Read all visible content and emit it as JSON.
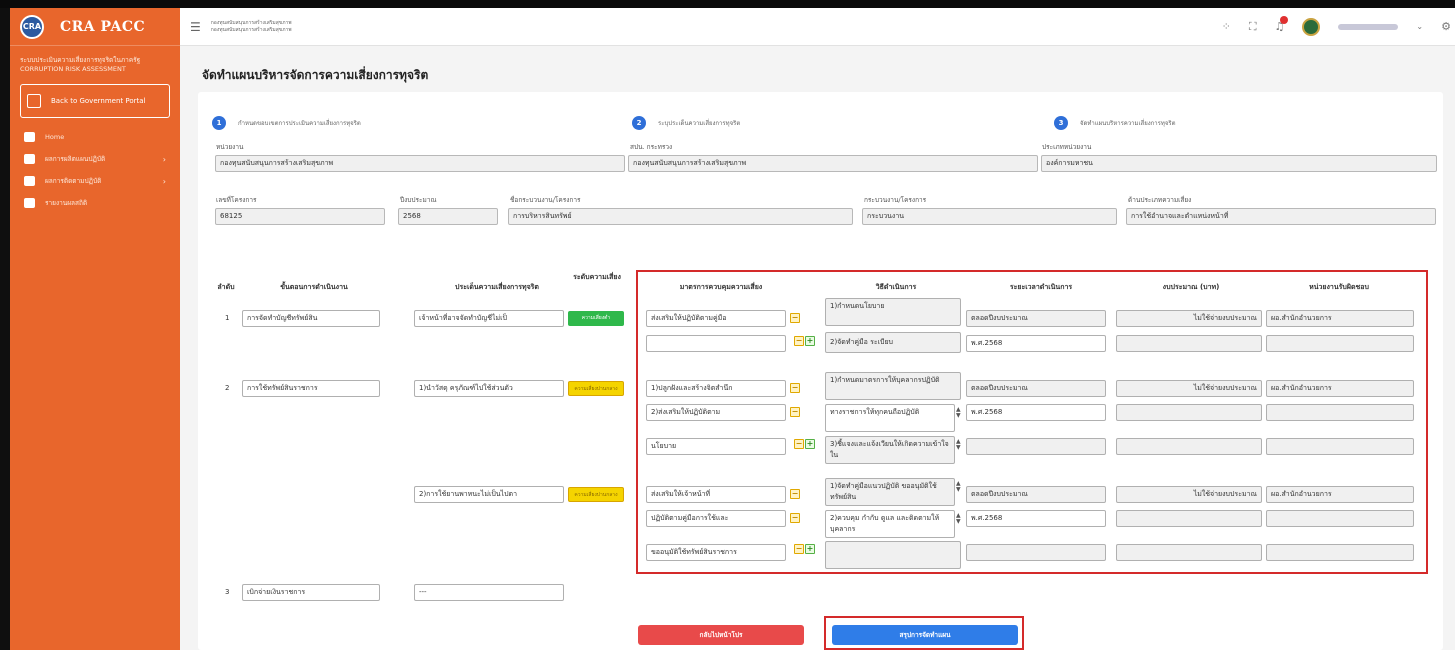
{
  "app": {
    "name": "CRA PACC",
    "logo_text": "CRA"
  },
  "sidebar": {
    "subtitle": "ระบบประเมินความเสี่ยงการทุจริตในภาครัฐ CORRUPTION RISK ASSESSMENT",
    "back_button": "Back to Government Portal",
    "items": [
      {
        "label": "Home",
        "icon": "home-icon"
      },
      {
        "label": "ผลการผลิตแผนปฏิบัติ",
        "icon": "edit-icon"
      },
      {
        "label": "ผลการติดตามปฏิบัติ",
        "icon": "document-icon"
      },
      {
        "label": "รายงานผลสถิติ",
        "icon": "chart-icon"
      }
    ]
  },
  "header": {
    "breadcrumb_line1": "กองทุนสนับสนุนการสร้างเสริมสุขภาพ",
    "breadcrumb_line2": "กองทุนสนับสนุนการสร้างเสริมสุขภาพ"
  },
  "page": {
    "title": "จัดทำแผนบริหารจัดการความเสี่ยงการทุจริต"
  },
  "steps": [
    {
      "num": "1",
      "label": "กำหนดขอบเขตการประเมินความเสี่ยงการทุจริต"
    },
    {
      "num": "2",
      "label": "ระบุประเด็นความเสี่ยงการทุจริต"
    },
    {
      "num": "3",
      "label": "จัดทำแผนบริหารความเสี่ยงการทุจริต"
    }
  ],
  "form": {
    "agency_label": "หน่วยงาน",
    "agency_value": "กองทุนสนับสนุนการสร้างเสริมสุขภาพ",
    "ministry_label": "สปน. กระทรวง",
    "ministry_value": "กองทุนสนับสนุนการสร้างเสริมสุขภาพ",
    "type_label": "ประเภทหน่วยงาน",
    "type_value": "องค์การมหาชน",
    "project_no_label": "เลขที่โครงการ",
    "project_no_value": "68125",
    "year_label": "ปีงบประมาณ",
    "year_value": "2568",
    "project_name_label": "ชื่อกระบวนงาน/โครงการ",
    "project_name_value": "การบริหารสินทรัพย์",
    "process_label": "กระบวนงาน/โครงการ",
    "process_value": "กระบวนงาน",
    "risk_type_label": "ด้านประเภทความเสี่ยง",
    "risk_type_value": "การใช้อำนาจและตำแหน่งหน้าที่"
  },
  "table": {
    "headers": [
      "ลำดับ",
      "ขั้นตอนการดำเนินงาน",
      "ประเด็นความเสี่ยงการทุจริต",
      "ระดับความเสี่ยง",
      "มาตรการควบคุมความเสี่ยง",
      "วิธีดำเนินการ",
      "ระยะเวลาดำเนินการ",
      "งบประมาณ (บาท)",
      "หน่วยงานรับผิดชอบ"
    ],
    "row1": {
      "num": "1",
      "step": "การจัดทำบัญชีทรัพย์สิน",
      "risk": "เจ้าหน้าที่อาจจัดทำบัญชีไม่เป็",
      "level": "ความเสี่ยงต่ำ",
      "measure1": "ส่งเสริมให้ปฏิบัติตามคู่มือ",
      "measure2": "",
      "method1": "1)กำหนดนโยบาย",
      "method2": "2)จัดทำคู่มือ ระเบียบ",
      "period1": "ตลอดปีงบประมาณ",
      "period2": "พ.ศ.2568",
      "budget1": "ไม่ใช้จ่ายงบประมาณ",
      "unit1": "ผอ.สำนักอำนวยการ"
    },
    "row2": {
      "num": "2",
      "step": "การใช้ทรัพย์สินราชการ",
      "risk": "1)นำวัสดุ ครุภัณฑ์ไปใช้ส่วนตัว",
      "level": "ความเสี่ยงปานกลาง",
      "measure1": "1)ปลูกฝังและสร้างจิตสำนึก",
      "measure2": "2)ส่งเสริมให้ปฏิบัติตาม",
      "measure3": "นโยบาย",
      "method1": "1)กำหนดมาตรการให้บุคลากรปฏิบัติ",
      "method2": "ทางราชการให้ทุกคนถือปฏิบัติ",
      "method3": "3)ชี้แจงและแจ้งเวียนให้เกิดความเข้าใจใน",
      "period1": "ตลอดปีงบประมาณ",
      "period2": "พ.ศ.2568",
      "budget1": "ไม่ใช้จ่ายงบประมาณ",
      "unit1": "ผอ.สำนักอำนวยการ"
    },
    "row2b": {
      "risk": "2)การใช้ยานพาหนะไม่เป็นไปตา",
      "level": "ความเสี่ยงปานกลาง",
      "measure1": "ส่งเสริมให้เจ้าหน้าที่",
      "measure2": "ปฏิบัติตามคู่มือการใช้และ",
      "measure3": "ขออนุมัติใช้ทรัพย์สินราชการ",
      "method1": "1)จัดทำคู่มือแนวปฏิบัติ ขออนุมัติใช้ทรัพย์สิน",
      "method2": "2)ควบคุม กำกับ ดูแล และติดตามให้บุคลากร",
      "period1": "ตลอดปีงบประมาณ",
      "period2": "พ.ศ.2568",
      "budget1": "ไม่ใช้จ่ายงบประมาณ",
      "unit1": "ผอ.สำนักอำนวยการ"
    },
    "row3": {
      "num": "3",
      "step": "เบิกจ่ายเงินราชการ",
      "risk": "---"
    }
  },
  "buttons": {
    "back": "กลับไปหน้าโปร",
    "submit": "สรุปการจัดทำแผน"
  },
  "colors": {
    "sidebar": "#e8662c",
    "primary": "#2f7de8",
    "danger": "#e84a4a",
    "highlight": "#d42a2a"
  }
}
